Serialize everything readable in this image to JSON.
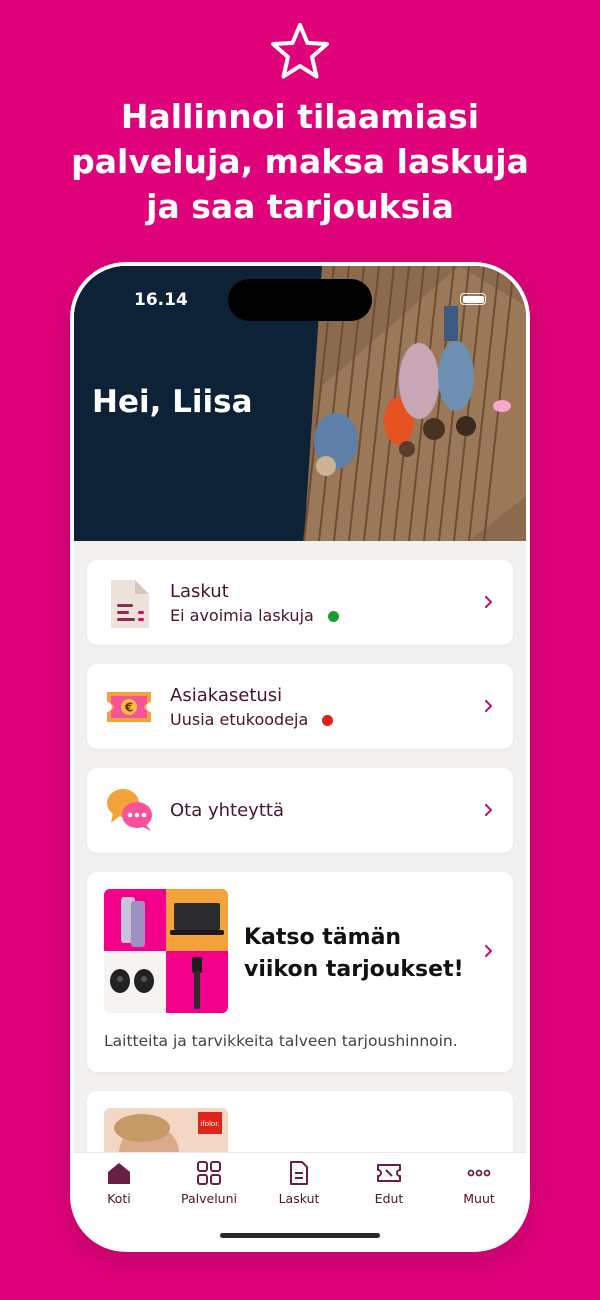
{
  "promo": {
    "star_icon": "star-icon",
    "headline_lines": [
      "Hallinnoi tilaamiasi",
      "palveluja, maksa laskuja",
      "ja saa tarjouksia"
    ]
  },
  "status_bar": {
    "time": "16.14"
  },
  "hero": {
    "greeting": "Hei, Liisa"
  },
  "cards": [
    {
      "title": "Laskut",
      "subtitle": "Ei avoimia laskuja",
      "status_color": "#1a9c2e",
      "icon": "document-icon"
    },
    {
      "title": "Asiakasetusi",
      "subtitle": "Uusia etukoodeja",
      "status_color": "#e0201f",
      "icon": "euro-ticket-icon"
    },
    {
      "title": "Ota yhteyttä",
      "icon": "chat-bubbles-icon"
    }
  ],
  "offer_card": {
    "title_lines": [
      "Katso tämän",
      "viikon tarjoukset!"
    ],
    "description": "Laitteita ja tarvikkeita talveen tarjoushinnoin."
  },
  "partial_card": {
    "badge": "ifolor."
  },
  "tabs": [
    {
      "label": "Koti",
      "icon": "home-icon",
      "active": true
    },
    {
      "label": "Palveluni",
      "icon": "grid-icon",
      "active": false
    },
    {
      "label": "Laskut",
      "icon": "document-icon",
      "active": false
    },
    {
      "label": "Edut",
      "icon": "ticket-icon",
      "active": false
    },
    {
      "label": "Muut",
      "icon": "more-icon",
      "active": false
    }
  ],
  "colors": {
    "brand": "#e0027a",
    "text_dark": "#4a1330",
    "chevron": "#c0106a"
  }
}
